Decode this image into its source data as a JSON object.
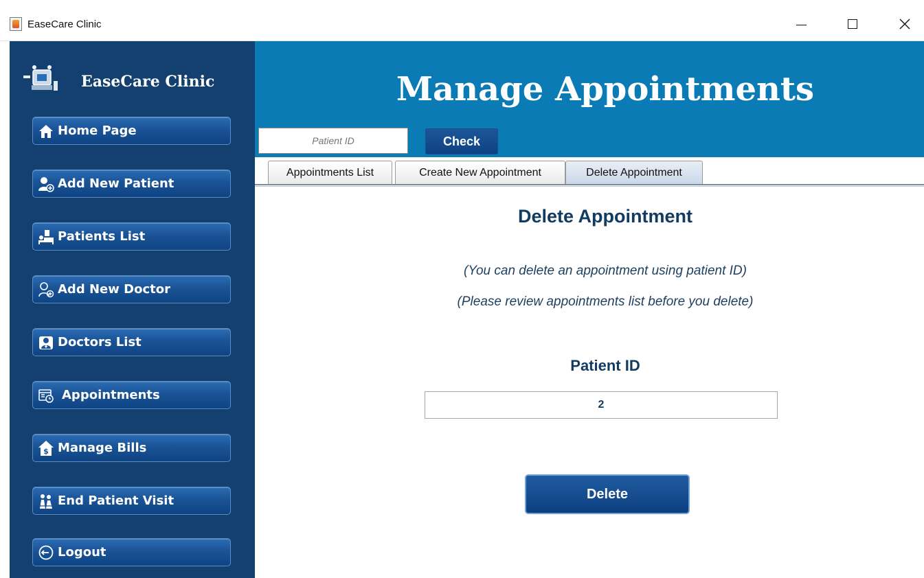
{
  "window": {
    "title": "EaseCare Clinic",
    "controls": {
      "minimize": "minimize-icon",
      "maximize": "maximize-icon",
      "close": "close-icon"
    }
  },
  "sidebar": {
    "brand": "EaseCare Clinic",
    "logo_icon": "clinic-logo-icon",
    "items": [
      {
        "label": "Home Page",
        "icon": "home-icon"
      },
      {
        "label": "Add New Patient",
        "icon": "add-patient-icon"
      },
      {
        "label": "Patients List",
        "icon": "patients-list-icon"
      },
      {
        "label": "Add New Doctor",
        "icon": "add-doctor-icon"
      },
      {
        "label": "Doctors List",
        "icon": "doctors-list-icon"
      },
      {
        "label": "Appointments",
        "icon": "appointments-icon"
      },
      {
        "label": "Manage Bills",
        "icon": "bills-icon"
      },
      {
        "label": "End Patient Visit",
        "icon": "end-visit-icon"
      },
      {
        "label": "Logout",
        "icon": "logout-icon"
      }
    ]
  },
  "header": {
    "title": "Manage Appointments",
    "search_placeholder": "Patient ID",
    "check_label": "Check"
  },
  "tabs": [
    {
      "label": "Appointments List",
      "active": false
    },
    {
      "label": "Create New Appointment",
      "active": false
    },
    {
      "label": "Delete Appointment",
      "active": true
    }
  ],
  "content": {
    "title": "Delete Appointment",
    "info1": "(You can delete an appointment using patient ID)",
    "info2": "(Please review appointments list before you delete)",
    "patient_id_label": "Patient ID",
    "patient_id_value": "2",
    "delete_label": "Delete"
  },
  "colors": {
    "sidebar_bg": "#13406f",
    "header_bg": "#0a7bb5",
    "button_bg": "#1a5396",
    "text_dark": "#123b62"
  }
}
